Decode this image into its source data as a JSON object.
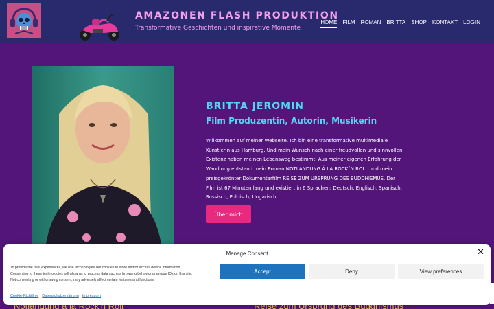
{
  "header": {
    "site_title": "AMAZONEN FLASH PRODUKTION",
    "tagline": "Transformative Geschichten und inspirative Momente",
    "logo_icon": "skull-headphones-logo",
    "bike_icon": "pink-motorcycle-icon"
  },
  "nav": {
    "items": [
      {
        "label": "HOME",
        "active": true
      },
      {
        "label": "FILM"
      },
      {
        "label": "ROMAN"
      },
      {
        "label": "BRITTA"
      },
      {
        "label": "SHOP"
      },
      {
        "label": "KONTAKT"
      },
      {
        "label": "LOGIN"
      }
    ]
  },
  "hero": {
    "name": "BRITTA JEROMIN",
    "subtitle": "Film Produzentin, Autorin, Musikerin",
    "intro_lines": [
      "Willkommen auf meiner Webseite. Ich bin eine transformative multimediale",
      "Künstlerin aus Hamburg. Und mein Wunsch nach einer freudvollen und sinnvollen",
      "Existenz haben meinen Lebensweg bestimmt. Aus meiner eigenen Erfahrung der",
      "Wandlung entstand mein Roman NOTLANDUNG Á LA ROCK´N ROLL und mein",
      "preisgekrönter Dokumentarfilm REISE ZUM URSPRUNG DES BUDDHISMUS. Der",
      "Film ist 67 Minuten lang und existiert in 6 Sprachen: Deutsch, Englisch, Spanisch,",
      "Russisch, Polnisch, Ungarisch."
    ],
    "button_label": "Über mich"
  },
  "sections_peek": {
    "left": "Notlandung á la Rock'n Roll",
    "right": "Reise zum Ursprung des Buddhismus"
  },
  "consent": {
    "title": "Manage Consent",
    "close_icon": "close-icon",
    "text_lines": [
      "To provide the best experiences, we use technologies like cookies to store and/or access device information.",
      "Consenting to these technologies will allow us to process data such as browsing behavior or unique IDs on this site.",
      "Not consenting or withdrawing consent, may adversely affect certain features and functions."
    ],
    "accept_label": "Accept",
    "deny_label": "Deny",
    "prefs_label": "View preferences",
    "links": [
      "Cookie-Richtlinie",
      "Datenschutzerklärung",
      "Impressum"
    ]
  },
  "colors": {
    "page_bg": "#53157a",
    "header_bg": "#29296e",
    "accent_pink": "#e8297f",
    "accent_cyan": "#56d5f2",
    "title_pink": "#f2a0ea",
    "consent_blue": "#1e73be"
  }
}
